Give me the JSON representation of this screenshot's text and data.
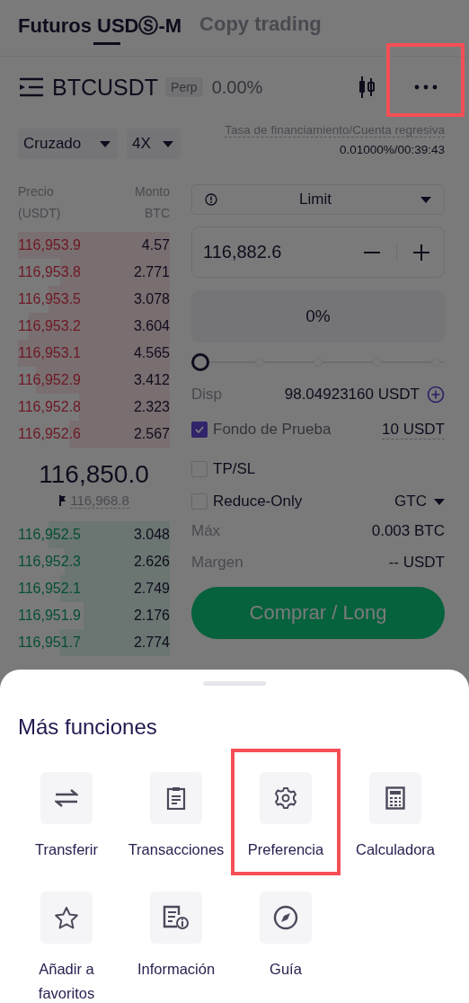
{
  "tabs": [
    {
      "label": "Futuros USDⓈ-M",
      "selected": true
    },
    {
      "label": "Copy trading",
      "selected": false
    }
  ],
  "symbol": {
    "name": "BTCUSDT",
    "badge": "Perp",
    "change": "0.00%",
    "more_highlighted": true
  },
  "margin_mode": "Cruzado",
  "leverage": "4X",
  "funding": {
    "label": "Tasa de financiamiento/Cuenta regresiva",
    "value": "0.01000%/00:39:43"
  },
  "order_book": {
    "price_header": [
      "Precio",
      "(USDT)"
    ],
    "amount_header": [
      "Monto",
      "BTC"
    ],
    "asks": [
      {
        "price": "116,953.9",
        "amount": "4.57"
      },
      {
        "price": "116,953.8",
        "amount": "2.771"
      },
      {
        "price": "116,953.5",
        "amount": "3.078"
      },
      {
        "price": "116,953.2",
        "amount": "3.604"
      },
      {
        "price": "116,953.1",
        "amount": "4.565"
      },
      {
        "price": "116,952.9",
        "amount": "3.412"
      },
      {
        "price": "116,952.8",
        "amount": "2.323"
      },
      {
        "price": "116,952.6",
        "amount": "2.567"
      }
    ],
    "last_price": "116,850.0",
    "mark_price": "116,968.8",
    "bids": [
      {
        "price": "116,952.5",
        "amount": "3.048"
      },
      {
        "price": "116,952.3",
        "amount": "2.626"
      },
      {
        "price": "116,952.1",
        "amount": "2.749"
      },
      {
        "price": "116,951.9",
        "amount": "2.176"
      },
      {
        "price": "116,951.7",
        "amount": "2.774"
      }
    ]
  },
  "order_form": {
    "order_type": "Limit",
    "price": "116,882.6",
    "percent": "0%",
    "slider": {
      "level": 0
    },
    "available": {
      "label": "Disp",
      "value": "98.04923160 USDT"
    },
    "options": [
      {
        "label": "Fondo de Prueba",
        "checked": true,
        "value": "10 USDT"
      },
      {
        "label": "TP/SL",
        "checked": false
      },
      {
        "label": "Reduce-Only",
        "checked": false,
        "value": "GTC"
      }
    ],
    "stats": [
      {
        "label": "Máx",
        "value": "0.003 BTC"
      },
      {
        "label": "Margen",
        "value": "-- USDT"
      }
    ],
    "buy_button": "Comprar / Long"
  },
  "sheet": {
    "title": "Más funciones",
    "items": [
      {
        "label": "Transferir",
        "kind": "transfer",
        "highlighted": false
      },
      {
        "label": "Transacciones",
        "kind": "clipboard",
        "highlighted": false
      },
      {
        "label": "Preferencia",
        "kind": "gear",
        "highlighted": true
      },
      {
        "label": "Calculadora",
        "kind": "calculator",
        "highlighted": false
      },
      {
        "label": "Añadir a favoritos",
        "kind": "star",
        "highlighted": false
      },
      {
        "label": "Información",
        "kind": "doc-info",
        "highlighted": false
      },
      {
        "label": "Guía",
        "kind": "compass",
        "highlighted": false
      }
    ]
  }
}
